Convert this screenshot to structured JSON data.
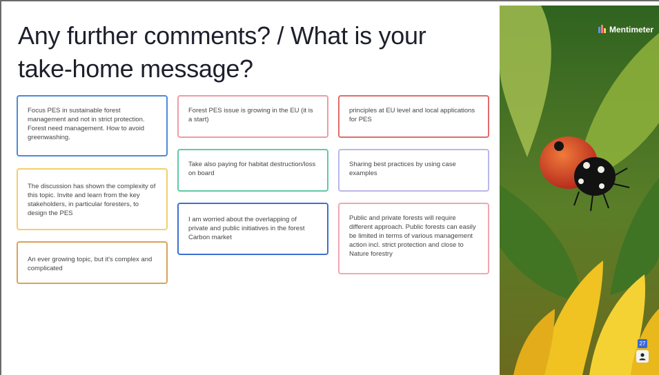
{
  "slide": {
    "title": "Any further comments? / What is your take-home message?"
  },
  "cards": [
    {
      "text": "Focus PES in sustainable forest management and not in strict protection. Forest need management. How to avoid greenwashing.",
      "color": "#4a8ad8"
    },
    {
      "text": "The discussion has shown the complexity of this topic. Invite and learn from the key stakeholders, in particular foresters, to design the PES",
      "color": "#f2cf6a"
    },
    {
      "text": "An ever growing topic, but it's complex and complicated",
      "color": "#d9a25a"
    },
    {
      "text": "Forest PES issue is growing in the EU (it is a start)",
      "color": "#ef9aa6"
    },
    {
      "text": "Take also paying for habitat destruction/loss on board",
      "color": "#5ecaa5"
    },
    {
      "text": "I am worried about the overlapping of private and public initiatives in the forest Carbon market",
      "color": "#3d6fd0"
    },
    {
      "text": "principles at EU level and local applications for PES",
      "color": "#e36a6a"
    },
    {
      "text": "Sharing best practices by using case examples",
      "color": "#b9b7ea"
    },
    {
      "text": "Public and private forests will require different approach. Public forests can easily be limited in terms of various management action incl. strict protection and close to Nature forestry",
      "color": "#f2a6b0"
    }
  ],
  "brand": {
    "name": "Mentimeter"
  },
  "participants": {
    "count": "27"
  }
}
